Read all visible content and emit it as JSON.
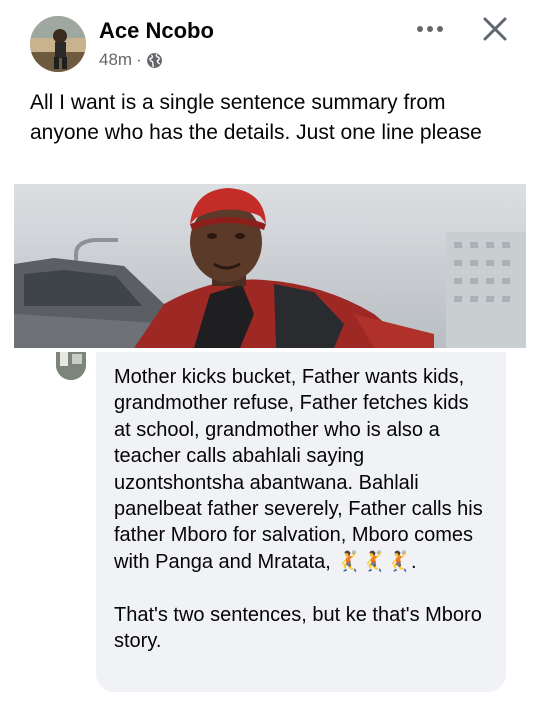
{
  "post": {
    "author_name": "Ace Ncobo",
    "timestamp": "48m",
    "separator": "·",
    "privacy_icon": "globe-icon",
    "menu_icon": "more-dots-icon",
    "close_icon": "close-icon",
    "caption": "All I want is a single sentence summary from anyone who has the details. Just one line please"
  },
  "comment": {
    "text": "Mother kicks bucket, Father wants kids, grandmother refuse, Father fetches kids at school, grandmother who is also a teacher calls abahlali saying uzontshontsha abantwana. Bahlali panelbeat father severely, Father calls his father Mboro for salvation, Mboro comes with Panga and Mratata, 🤾🤾🤾.\n\nThat's two sentences, but ke that's Mboro story."
  },
  "colors": {
    "text_primary": "#050505",
    "text_secondary": "#65676b",
    "comment_bg": "#f0f2f5"
  }
}
